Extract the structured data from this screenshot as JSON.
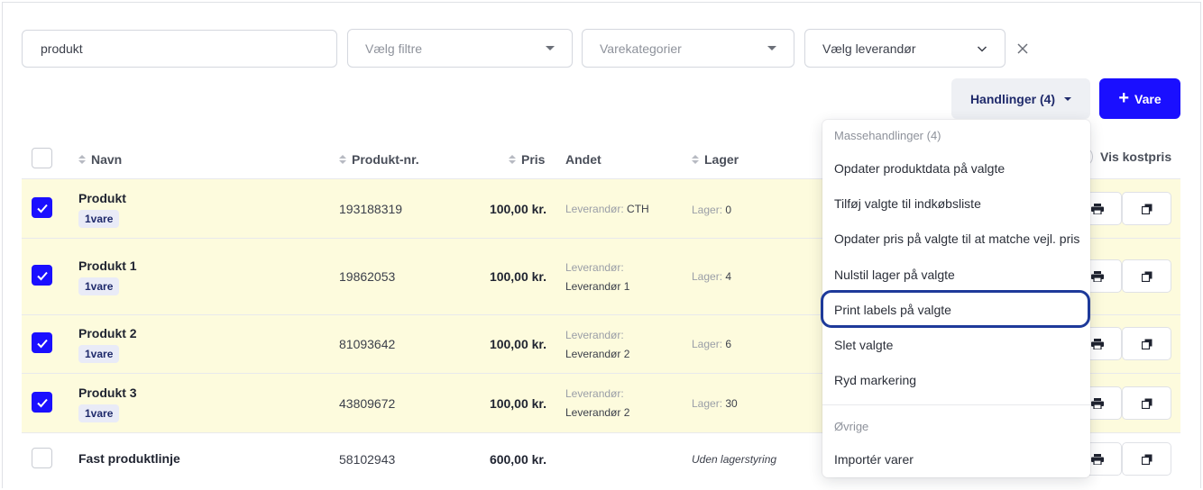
{
  "filters": {
    "search_value": "produkt",
    "filter_placeholder": "Vælg filtre",
    "category_placeholder": "Varekategorier",
    "supplier_value": "Vælg leverandør"
  },
  "toolbar": {
    "actions_label": "Handlinger (4)",
    "add_label": "Vare"
  },
  "table": {
    "headers": {
      "name": "Navn",
      "product_no": "Produkt-nr.",
      "price": "Pris",
      "other": "Andet",
      "stock": "Lager"
    },
    "vis_kostpris": "Vis kostpris",
    "rows": [
      {
        "name": "Produkt",
        "tag": "1vare",
        "number": "193188319",
        "price": "100,00 kr.",
        "supplier_label": "Leverandør:",
        "supplier": "CTH",
        "stock_label": "Lager:",
        "stock": "0"
      },
      {
        "name": "Produkt 1",
        "tag": "1vare",
        "number": "19862053",
        "price": "100,00 kr.",
        "supplier_label": "Leverandør:",
        "supplier": "Leverandør 1",
        "stock_label": "Lager:",
        "stock": "4"
      },
      {
        "name": "Produkt 2",
        "tag": "1vare",
        "number": "81093642",
        "price": "100,00 kr.",
        "supplier_label": "Leverandør:",
        "supplier": "Leverandør 2",
        "stock_label": "Lager:",
        "stock": "6"
      },
      {
        "name": "Produkt 3",
        "tag": "1vare",
        "number": "43809672",
        "price": "100,00 kr.",
        "supplier_label": "Leverandør:",
        "supplier": "Leverandør 2",
        "stock_label": "Lager:",
        "stock": "30"
      },
      {
        "name": "Fast produktlinje",
        "number": "58102943",
        "price": "600,00 kr.",
        "stock_text": "Uden lagerstyring"
      }
    ]
  },
  "menu": {
    "section1": "Massehandlinger (4)",
    "items": [
      "Opdater produktdata på valgte",
      "Tilføj valgte til indkøbsliste",
      "Opdater pris på valgte til at matche vejl. pris",
      "Nulstil lager på valgte",
      "Print labels på valgte",
      "Slet valgte",
      "Ryd markering"
    ],
    "section2": "Øvrige",
    "import": "Importér varer"
  },
  "colors": {
    "accent": "#1a0fff",
    "selected_row": "#fdfbdd",
    "highlight_ring": "#1e3a9a"
  }
}
